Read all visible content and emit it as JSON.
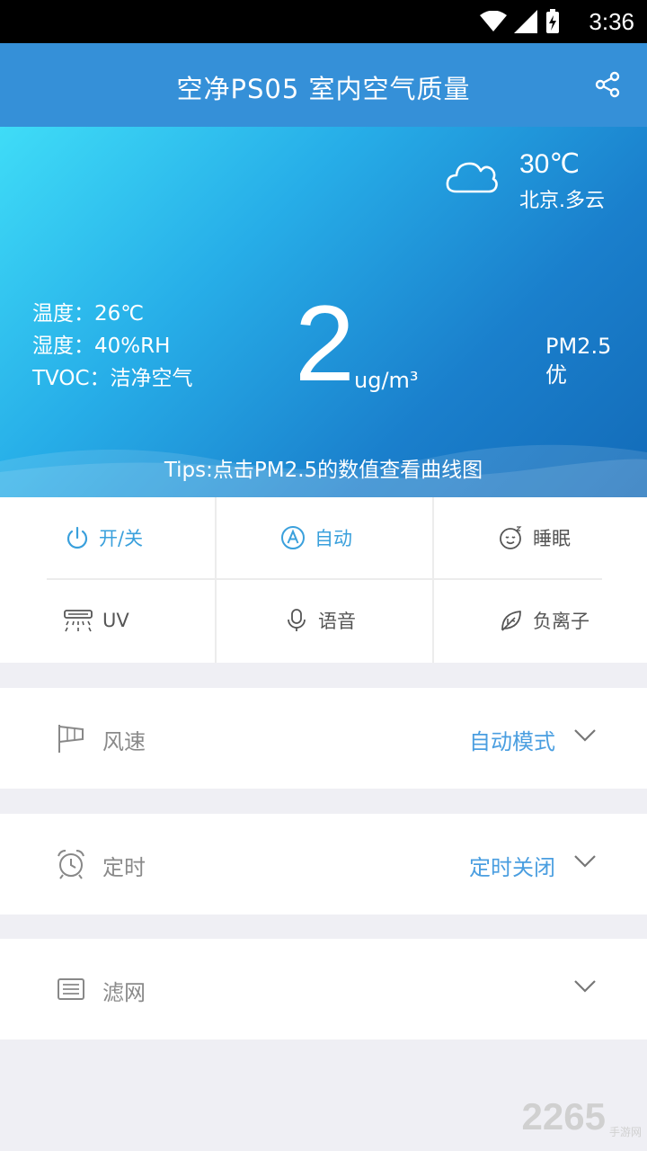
{
  "status_bar": {
    "time": "3:36"
  },
  "app_bar": {
    "title": "空净PS05  室内空气质量",
    "share_icon": "share-icon"
  },
  "weather": {
    "temperature": "30℃",
    "location": "北京.多云",
    "icon": "cloud-icon"
  },
  "environment": {
    "temperature": "温度：26℃",
    "humidity": "湿度：40%RH",
    "tvoc": "TVOC：洁净空气"
  },
  "pm25": {
    "value": "2",
    "unit": "ug/m³",
    "label": "PM2.5",
    "quality": "优"
  },
  "tips": "Tips:点击PM2.5的数值查看曲线图",
  "controls": [
    {
      "label": "开/关",
      "icon": "power-icon",
      "active": true
    },
    {
      "label": "自动",
      "icon": "auto-icon",
      "active": true
    },
    {
      "label": "睡眠",
      "icon": "sleep-face-icon",
      "active": false
    },
    {
      "label": "UV",
      "icon": "uv-lamp-icon",
      "active": false
    },
    {
      "label": "语音",
      "icon": "microphone-icon",
      "active": false
    },
    {
      "label": "负离子",
      "icon": "leaf-icon",
      "active": false
    }
  ],
  "settings": {
    "fan_speed": {
      "label": "风速",
      "value": "自动模式",
      "icon": "windsock-icon"
    },
    "timer": {
      "label": "定时",
      "value": "定时关闭",
      "icon": "alarm-clock-icon"
    },
    "filter": {
      "label": "滤网",
      "value": "",
      "icon": "filter-list-icon"
    }
  },
  "watermark": {
    "number": "2265",
    "site": "手游网"
  },
  "colors": {
    "app_bar": "#3590d8",
    "accent": "#3aa0dc",
    "value_blue": "#4a9ee0"
  }
}
